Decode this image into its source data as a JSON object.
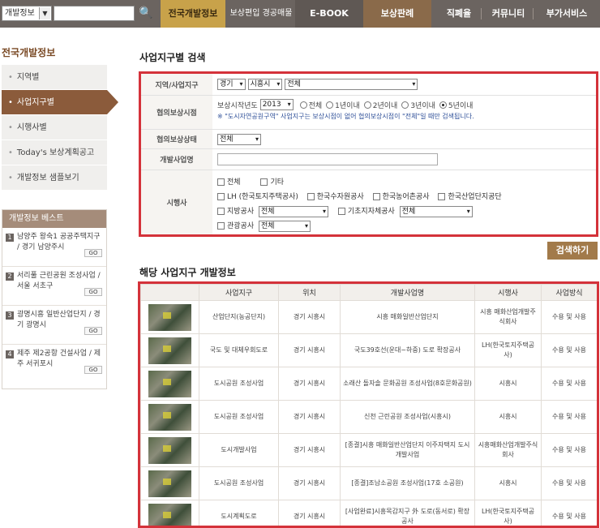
{
  "topbar": {
    "search_select": "개발정보",
    "nav": [
      "전국개발정보",
      "보상편입 경공매물건",
      "E-BOOK",
      "보상판례",
      "직폐율",
      "커뮤니티",
      "부가서비스"
    ]
  },
  "sidebar": {
    "title": "전국개발정보",
    "items": [
      "지역별",
      "사업지구별",
      "시행사별",
      "Today's 보상계획공고",
      "개발정보 샘플보기"
    ],
    "best_title": "개발정보 베스트",
    "best": [
      {
        "num": "1",
        "text": "남양주 왕숙1 공공주택지구 / 경기 남양주시"
      },
      {
        "num": "2",
        "text": "서리풀 근린공원 조성사업 / 서울 서초구"
      },
      {
        "num": "3",
        "text": "광명시흥 일반산업단지 / 경기 광명시"
      },
      {
        "num": "4",
        "text": "제주 제2공항 건설사업 / 제주 서귀포시"
      }
    ],
    "go_label": "GO"
  },
  "search": {
    "title": "사업지구별 검색",
    "region_label": "지역/사업지구",
    "region_values": [
      "경기",
      "시흥시",
      "전체"
    ],
    "period_label": "협의보상시점",
    "period_prefix": "보상시작년도",
    "year": "2013",
    "period_options": [
      "전체",
      "1년이내",
      "2년이내",
      "3년이내",
      "5년이내"
    ],
    "note": "※ \"도시자연공원구역\" 사업지구는 보상시점이 없어 협의보상시점이 \"전체\"일 때만 검색됩니다.",
    "status_label": "협의보상상태",
    "status_value": "전체",
    "name_label": "개발사업명",
    "executor_label": "시행사",
    "executor_row1": [
      "전체",
      "기타"
    ],
    "executor_row2": [
      "LH (한국토지주택공사)",
      "한국수자원공사",
      "한국농어촌공사",
      "한국산업단지공단"
    ],
    "executor_local": "지방공사",
    "executor_local_value": "전체",
    "executor_city": "기초지자체공사",
    "executor_city_value": "전체",
    "executor_gov": "관광공사",
    "executor_gov_value": "전체",
    "submit": "검색하기"
  },
  "results": {
    "title": "해당 사업지구 개발정보",
    "headers": [
      "",
      "사업지구",
      "위치",
      "개발사업명",
      "시행사",
      "사업방식"
    ],
    "rows": [
      {
        "district": "산업단지(농공단지)",
        "location": "경기 시흥시",
        "name": "시흥 매화일반산업단지",
        "executor": "시흥 매화산업개발주식회사",
        "method": "수용 및 사용"
      },
      {
        "district": "국도 및 대체우회도로",
        "location": "경기 시흥시",
        "name": "국도39호선(운대~하중) 도로 확장공사",
        "executor": "LH(한국토지주택공사)",
        "method": "수용 및 사용"
      },
      {
        "district": "도시공원 조성사업",
        "location": "경기 시흥시",
        "name": "소래산 돌자솔 문화공원 조성사업(8호문화공원)",
        "executor": "시흥시",
        "method": "수용 및 사용"
      },
      {
        "district": "도시공원 조성사업",
        "location": "경기 시흥시",
        "name": "신천 근린공원 조성사업(시흥시)",
        "executor": "시흥시",
        "method": "수용 및 사용"
      },
      {
        "district": "도시개발사업",
        "location": "경기 시흥시",
        "name": "[종결]시흥 매화일반산업단지 이주자택지 도시개발사업",
        "executor": "시흥매화산업개발주식회사",
        "method": "수용 및 사용"
      },
      {
        "district": "도시공원 조성사업",
        "location": "경기 시흥시",
        "name": "[종결]조남소공원 조성사업(17호 소공원)",
        "executor": "시흥시",
        "method": "수용 및 사용"
      },
      {
        "district": "도시계획도로",
        "location": "경기 시흥시",
        "name": "[사업완료]시흥목감지구 外 도로(동서로) 확장공사",
        "executor": "LH(한국토지주택공사)",
        "method": "수용 및 사용"
      }
    ]
  }
}
